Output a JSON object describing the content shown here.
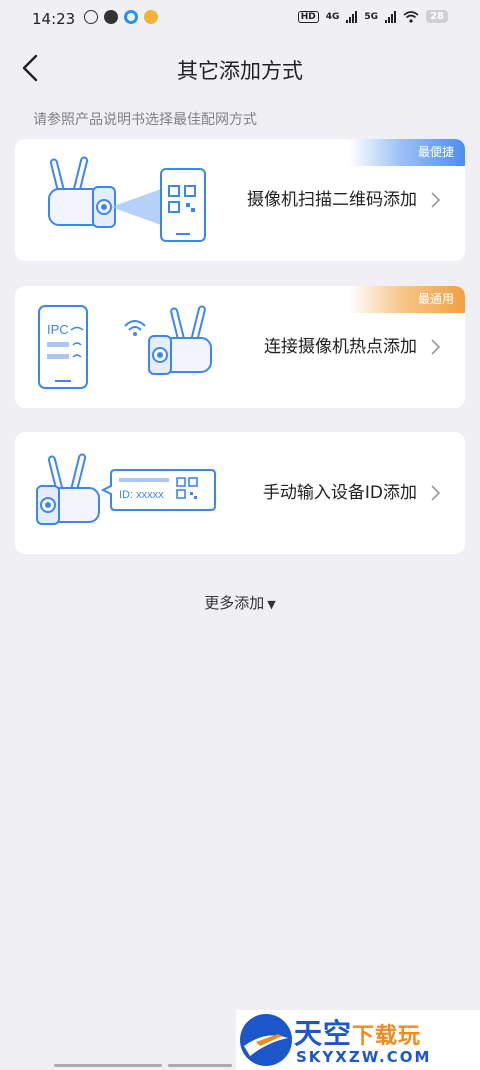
{
  "status_bar": {
    "time": "14:23",
    "battery": "28",
    "net_hd": "HD",
    "net_4g": "4G",
    "net_5g": "5G"
  },
  "header": {
    "title": "其它添加方式"
  },
  "subtitle": "请参照产品说明书选择最佳配网方式",
  "options": [
    {
      "label": "摄像机扫描二维码添加",
      "badge": "最便捷"
    },
    {
      "label": "连接摄像机热点添加",
      "badge": "最通用",
      "phone_text": "IPC"
    },
    {
      "label": "手动输入设备ID添加",
      "id_text": "ID: xxxxx"
    }
  ],
  "more": {
    "label": "更多添加",
    "arrow": "▼"
  },
  "watermark": {
    "title_a": "天空",
    "title_b": "下载玩",
    "domain": "SKYXZW.COM"
  },
  "colors": {
    "background": "#efeff4",
    "illustration_blue": "#3d86ee",
    "badge_blue": "#4e8ef0",
    "badge_orange": "#f0a041"
  }
}
